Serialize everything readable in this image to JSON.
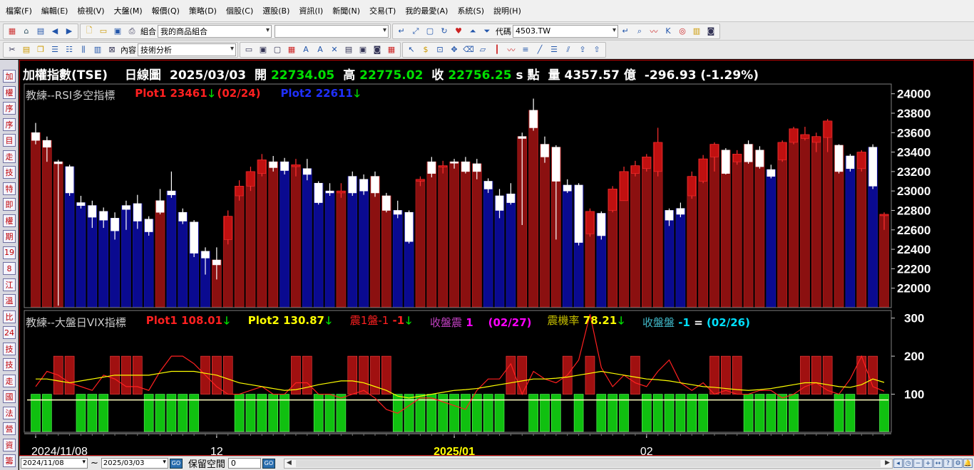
{
  "menu": [
    "檔案(F)",
    "編輯(E)",
    "檢視(V)",
    "大盤(M)",
    "報價(Q)",
    "策略(D)",
    "個股(C)",
    "選股(B)",
    "資訊(I)",
    "新聞(N)",
    "交易(T)",
    "我的最愛(A)",
    "系統(S)",
    "說明(H)"
  ],
  "toolbar": {
    "portfolio_label": "組合",
    "portfolio_value": "我的商品組合",
    "symbol_label": "代碼",
    "symbol_value": "4503.TW",
    "content_label": "內容",
    "content_value": "技術分析"
  },
  "sidebar_tabs": [
    "加",
    "權",
    "序",
    "序",
    "目",
    "走",
    "技",
    "特",
    "即",
    "權",
    "期",
    "19",
    "8",
    "江",
    "溫",
    "比",
    "24",
    "技",
    "技",
    "走",
    "國",
    "法",
    "營",
    "資",
    "籌"
  ],
  "header": {
    "name": "加權指數(TSE)",
    "period": "日線圖",
    "date": "2025/03/03",
    "open_label": "開",
    "open": "22734.05",
    "high_label": "高",
    "high": "22775.02",
    "close_label": "收",
    "close": "22756.25",
    "unit": "s 點",
    "vol_label": "量",
    "volume": "4357.57 億",
    "change": "-296.93 (-1.29%)"
  },
  "panel1": {
    "name": "教練--RSI多空指標",
    "plot1_label": "Plot1",
    "plot1_value": "23461",
    "plot1_date": "(02/24)",
    "plot2_label": "Plot2",
    "plot2_value": "22611"
  },
  "panel2": {
    "name": "教練--大盤日VIX指標",
    "plot1_label": "Plot1",
    "plot1_value": "108.01",
    "plot2_label": "Plot2",
    "plot2_value": "130.87",
    "shake_label": "震1盤-1",
    "shake_value": "-1",
    "close_shake_label": "收盤震",
    "close_shake_value": "1",
    "close_shake_date": "(02/27)",
    "rate_label": "震機率",
    "rate_value": "78.21",
    "close_close_label": "收盤盤",
    "close_close_value": "-1",
    "equals": "=",
    "close_close_date": "(02/26)"
  },
  "x_labels": [
    "2024/11/08",
    "12",
    "2025/01",
    "02"
  ],
  "bottom": {
    "start_date": "2024/11/08",
    "tilde": "~",
    "end_date": "2025/03/03",
    "go": "GO",
    "keep_label": "保留空間",
    "keep_value": "0"
  },
  "colors": {
    "up": "#8b1010",
    "down": "#0a0a90",
    "green_bar": "#10c010",
    "red_bar": "#a01010",
    "plot1_red": "#ff2020",
    "plot2_yellow": "#ffff00",
    "plot2_blue": "#2030ff",
    "magenta": "#ff00ff",
    "cyan": "#00e0ff"
  },
  "chart_data": {
    "type": "candlestick",
    "y_ticks": [
      "24000",
      "23800",
      "23600",
      "23400",
      "23200",
      "23000",
      "22800",
      "22600",
      "22400",
      "22200",
      "22000"
    ],
    "ylim": [
      21800,
      24100
    ],
    "vix_y_ticks": [
      "300",
      "200",
      "100"
    ],
    "vix_ylim": [
      0,
      320
    ],
    "candles": [
      {
        "o": 23600,
        "c": 23520,
        "h": 23700,
        "l": 23480,
        "ind": "up"
      },
      {
        "o": 23520,
        "c": 23450,
        "h": 23560,
        "l": 23300,
        "ind": "up"
      },
      {
        "o": 23300,
        "c": 23280,
        "h": 23320,
        "l": 21820,
        "ind": "up"
      },
      {
        "o": 23250,
        "c": 22980,
        "h": 23270,
        "l": 22950,
        "ind": "down"
      },
      {
        "o": 22880,
        "c": 22850,
        "h": 22950,
        "l": 22820,
        "ind": "down"
      },
      {
        "o": 22850,
        "c": 22730,
        "h": 22900,
        "l": 22620,
        "ind": "down"
      },
      {
        "o": 22790,
        "c": 22700,
        "h": 22830,
        "l": 22620,
        "ind": "down"
      },
      {
        "o": 22720,
        "c": 22590,
        "h": 22780,
        "l": 22500,
        "ind": "down"
      },
      {
        "o": 22850,
        "c": 22810,
        "h": 22900,
        "l": 22600,
        "ind": "down"
      },
      {
        "o": 22870,
        "c": 22690,
        "h": 22960,
        "l": 22610,
        "ind": "down"
      },
      {
        "o": 22710,
        "c": 22580,
        "h": 22740,
        "l": 22540,
        "ind": "down"
      },
      {
        "o": 22900,
        "c": 22780,
        "h": 23020,
        "l": 22760,
        "ind": "up"
      },
      {
        "o": 23000,
        "c": 22960,
        "h": 23200,
        "l": 22930,
        "ind": "down"
      },
      {
        "o": 22780,
        "c": 22690,
        "h": 22820,
        "l": 22660,
        "ind": "down"
      },
      {
        "o": 22680,
        "c": 22360,
        "h": 22700,
        "l": 22320,
        "ind": "down"
      },
      {
        "o": 22380,
        "c": 22310,
        "h": 22420,
        "l": 22140,
        "ind": "down"
      },
      {
        "o": 22290,
        "c": 22240,
        "h": 22420,
        "l": 22090,
        "ind": "up"
      },
      {
        "o": 22500,
        "c": 22740,
        "h": 22800,
        "l": 22450,
        "ind": "up"
      },
      {
        "o": 22950,
        "c": 23050,
        "h": 23110,
        "l": 22900,
        "ind": "up"
      },
      {
        "o": 23050,
        "c": 23200,
        "h": 23250,
        "l": 23000,
        "ind": "up"
      },
      {
        "o": 23180,
        "c": 23320,
        "h": 23380,
        "l": 23150,
        "ind": "up"
      },
      {
        "o": 23300,
        "c": 23240,
        "h": 23360,
        "l": 23200,
        "ind": "up"
      },
      {
        "o": 23300,
        "c": 23210,
        "h": 23340,
        "l": 23170,
        "ind": "down"
      },
      {
        "o": 23250,
        "c": 23270,
        "h": 23330,
        "l": 23150,
        "ind": "up"
      },
      {
        "o": 23230,
        "c": 23170,
        "h": 23330,
        "l": 23110,
        "ind": "down"
      },
      {
        "o": 23080,
        "c": 22880,
        "h": 23100,
        "l": 22860,
        "ind": "down"
      },
      {
        "o": 23000,
        "c": 22980,
        "h": 23080,
        "l": 22950,
        "ind": "down"
      },
      {
        "o": 22980,
        "c": 23000,
        "h": 23080,
        "l": 22930,
        "ind": "up"
      },
      {
        "o": 23150,
        "c": 22980,
        "h": 23200,
        "l": 22950,
        "ind": "down"
      },
      {
        "o": 23120,
        "c": 23000,
        "h": 23170,
        "l": 22960,
        "ind": "down"
      },
      {
        "o": 23150,
        "c": 22980,
        "h": 23200,
        "l": 22940,
        "ind": "up"
      },
      {
        "o": 22950,
        "c": 22800,
        "h": 22980,
        "l": 22780,
        "ind": "up"
      },
      {
        "o": 22800,
        "c": 22760,
        "h": 22900,
        "l": 22720,
        "ind": "down"
      },
      {
        "o": 22780,
        "c": 22480,
        "h": 22800,
        "l": 22460,
        "ind": "down"
      },
      {
        "o": 23100,
        "c": 23120,
        "h": 23150,
        "l": 23050,
        "ind": "up"
      },
      {
        "o": 23300,
        "c": 23180,
        "h": 23350,
        "l": 23140,
        "ind": "up"
      },
      {
        "o": 23250,
        "c": 23260,
        "h": 23310,
        "l": 23180,
        "ind": "up"
      },
      {
        "o": 23300,
        "c": 23290,
        "h": 23330,
        "l": 23230,
        "ind": "up"
      },
      {
        "o": 23300,
        "c": 23200,
        "h": 23350,
        "l": 23180,
        "ind": "up"
      },
      {
        "o": 23280,
        "c": 23200,
        "h": 23330,
        "l": 23120,
        "ind": "up"
      },
      {
        "o": 23100,
        "c": 23020,
        "h": 23130,
        "l": 22980,
        "ind": "down"
      },
      {
        "o": 22950,
        "c": 22800,
        "h": 23020,
        "l": 22720,
        "ind": "down"
      },
      {
        "o": 22970,
        "c": 22880,
        "h": 23080,
        "l": 22860,
        "ind": "down"
      },
      {
        "o": 23560,
        "c": 23540,
        "h": 23600,
        "l": 22650,
        "ind": "up"
      },
      {
        "o": 23830,
        "c": 23650,
        "h": 23950,
        "l": 23620,
        "ind": "up"
      },
      {
        "o": 23480,
        "c": 23350,
        "h": 23560,
        "l": 23290,
        "ind": "up"
      },
      {
        "o": 23450,
        "c": 23100,
        "h": 23470,
        "l": 22500,
        "ind": "up"
      },
      {
        "o": 23060,
        "c": 23000,
        "h": 23120,
        "l": 22980,
        "ind": "down"
      },
      {
        "o": 23060,
        "c": 22470,
        "h": 23080,
        "l": 22440,
        "ind": "down"
      },
      {
        "o": 22560,
        "c": 22790,
        "h": 22820,
        "l": 22530,
        "ind": "up"
      },
      {
        "o": 22770,
        "c": 22540,
        "h": 22790,
        "l": 22500,
        "ind": "down"
      },
      {
        "o": 22800,
        "c": 23020,
        "h": 23050,
        "l": 22780,
        "ind": "up"
      },
      {
        "o": 22900,
        "c": 23200,
        "h": 23250,
        "l": 22900,
        "ind": "up"
      },
      {
        "o": 23180,
        "c": 23260,
        "h": 23310,
        "l": 23150,
        "ind": "up"
      },
      {
        "o": 23230,
        "c": 23350,
        "h": 23380,
        "l": 23200,
        "ind": "up"
      },
      {
        "o": 23200,
        "c": 23500,
        "h": 23650,
        "l": 23150,
        "ind": "up"
      },
      {
        "o": 22800,
        "c": 22700,
        "h": 22820,
        "l": 22640,
        "ind": "down"
      },
      {
        "o": 22820,
        "c": 22760,
        "h": 22880,
        "l": 22730,
        "ind": "down"
      },
      {
        "o": 22950,
        "c": 23150,
        "h": 23200,
        "l": 22920,
        "ind": "up"
      },
      {
        "o": 23100,
        "c": 23330,
        "h": 23370,
        "l": 23080,
        "ind": "up"
      },
      {
        "o": 23350,
        "c": 23480,
        "h": 23500,
        "l": 23200,
        "ind": "up"
      },
      {
        "o": 23420,
        "c": 23180,
        "h": 23440,
        "l": 23170,
        "ind": "up"
      },
      {
        "o": 23300,
        "c": 23380,
        "h": 23420,
        "l": 23270,
        "ind": "up"
      },
      {
        "o": 23480,
        "c": 23300,
        "h": 23520,
        "l": 23280,
        "ind": "up"
      },
      {
        "o": 23420,
        "c": 23250,
        "h": 23460,
        "l": 23230,
        "ind": "up"
      },
      {
        "o": 23220,
        "c": 23150,
        "h": 23270,
        "l": 23130,
        "ind": "down"
      },
      {
        "o": 23320,
        "c": 23500,
        "h": 23520,
        "l": 23300,
        "ind": "up"
      },
      {
        "o": 23500,
        "c": 23640,
        "h": 23660,
        "l": 23480,
        "ind": "up"
      },
      {
        "o": 23540,
        "c": 23580,
        "h": 23660,
        "l": 23520,
        "ind": "up"
      },
      {
        "o": 23500,
        "c": 23560,
        "h": 23600,
        "l": 23400,
        "ind": "up"
      },
      {
        "o": 23550,
        "c": 23720,
        "h": 23740,
        "l": 23400,
        "ind": "up"
      },
      {
        "o": 23470,
        "c": 23200,
        "h": 23480,
        "l": 23180,
        "ind": "up"
      },
      {
        "o": 23360,
        "c": 23230,
        "h": 23380,
        "l": 23200,
        "ind": "down"
      },
      {
        "o": 23230,
        "c": 23400,
        "h": 23420,
        "l": 23200,
        "ind": "up"
      },
      {
        "o": 23450,
        "c": 23050,
        "h": 23480,
        "l": 23020,
        "ind": "down"
      },
      {
        "o": 22750,
        "c": 22760,
        "h": 22780,
        "l": 22600,
        "ind": "up"
      }
    ],
    "vix_regime": [
      "g",
      "g",
      "r",
      "r",
      "g",
      "g",
      "g",
      "r",
      "r",
      "r",
      "g",
      "g",
      "g",
      "g",
      "g",
      "r",
      "r",
      "r",
      "g",
      "g",
      "g",
      "g",
      "g",
      "r",
      "r",
      "g",
      "g",
      "g",
      "r",
      "r",
      "r",
      "r",
      "g",
      "g",
      "g",
      "g",
      "g",
      "g",
      "g",
      "g",
      "g",
      "g",
      "r",
      "r",
      "g",
      "g",
      "g",
      "r",
      "g",
      "r",
      "g",
      "g",
      "g",
      "r",
      "g",
      "g",
      "g",
      "g",
      "g",
      "g",
      "r",
      "r",
      "r",
      "g",
      "g",
      "g",
      "g",
      "g",
      "r",
      "r",
      "r",
      "g",
      "g",
      "r",
      "r",
      "g"
    ],
    "vix_line1": [
      120,
      160,
      150,
      130,
      120,
      110,
      150,
      140,
      120,
      120,
      110,
      160,
      200,
      200,
      180,
      150,
      120,
      100,
      100,
      110,
      120,
      100,
      100,
      130,
      130,
      100,
      100,
      90,
      100,
      110,
      90,
      60,
      50,
      70,
      90,
      90,
      80,
      70,
      60,
      110,
      140,
      140,
      180,
      100,
      160,
      140,
      130,
      150,
      190,
      310,
      170,
      120,
      150,
      130,
      120,
      160,
      190,
      130,
      110,
      130,
      100,
      110,
      100,
      100,
      110,
      110,
      90,
      100,
      120,
      130,
      110,
      100,
      140,
      200,
      120,
      108
    ],
    "vix_line2": [
      140,
      140,
      135,
      130,
      135,
      140,
      145,
      150,
      150,
      150,
      150,
      155,
      160,
      160,
      160,
      155,
      150,
      140,
      130,
      125,
      120,
      115,
      110,
      112,
      118,
      125,
      130,
      135,
      135,
      130,
      120,
      110,
      95,
      90,
      95,
      100,
      105,
      110,
      112,
      115,
      120,
      125,
      130,
      135,
      140,
      140,
      142,
      145,
      150,
      155,
      160,
      155,
      150,
      145,
      140,
      138,
      135,
      130,
      125,
      120,
      118,
      115,
      112,
      110,
      112,
      115,
      120,
      125,
      130,
      130,
      125,
      120,
      118,
      125,
      140,
      131
    ],
    "vix_threshold": 85
  }
}
